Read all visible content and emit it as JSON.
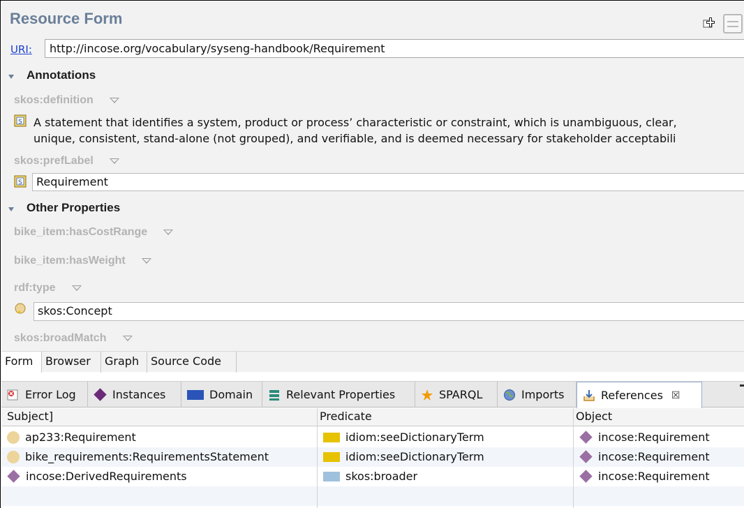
{
  "form": {
    "title": "Resource Form",
    "uri_label": "URI:",
    "uri_value": "http://incose.org/vocabulary/syseng-handbook/Requirement"
  },
  "sections": {
    "annotations": "Annotations",
    "other_properties": "Other Properties"
  },
  "props": {
    "definition_label": "skos:definition",
    "definition_line1": "A statement that identifies a system, product or process’ characteristic or constraint, which is unambiguous, clear,",
    "definition_line2": "unique, consistent, stand-alone (not grouped), and verifiable, and is deemed necessary for stakeholder acceptabili",
    "preflabel_label": "skos:prefLabel",
    "preflabel_value": "Requirement",
    "cost_label": "bike_item:hasCostRange",
    "weight_label": "bike_item:hasWeight",
    "type_label": "rdf:type",
    "type_value": "skos:Concept",
    "broadmatch_label": "skos:broadMatch"
  },
  "form_tabs": [
    "Form",
    "Browser",
    "Graph",
    "Source Code"
  ],
  "view_tabs": {
    "error_log": "Error Log",
    "instances": "Instances",
    "domain": "Domain",
    "relevant_properties": "Relevant Properties",
    "sparql": "SPARQL",
    "imports": "Imports",
    "references": "References",
    "close_glyph": "☒"
  },
  "table": {
    "headers": [
      "Subject]",
      "Predicate",
      "Object"
    ],
    "rows": [
      {
        "subject": "ap233:Requirement",
        "predicate": "idiom:seeDictionaryTerm",
        "object": "incose:Requirement"
      },
      {
        "subject": "bike_requirements:RequirementsStatement",
        "predicate": "idiom:seeDictionaryTerm",
        "object": "incose:Requirement"
      },
      {
        "subject": "incose:DerivedRequirements",
        "predicate": "skos:broader",
        "object": "incose:Requirement"
      }
    ]
  },
  "colors": {
    "title": "#6a7f98",
    "link": "#1a3fd1",
    "instance_diamond": "#9a6fa3",
    "class_dot": "#ecd49a",
    "predicate_yellow": "#e6c200",
    "predicate_blue": "#9fc1dd"
  }
}
